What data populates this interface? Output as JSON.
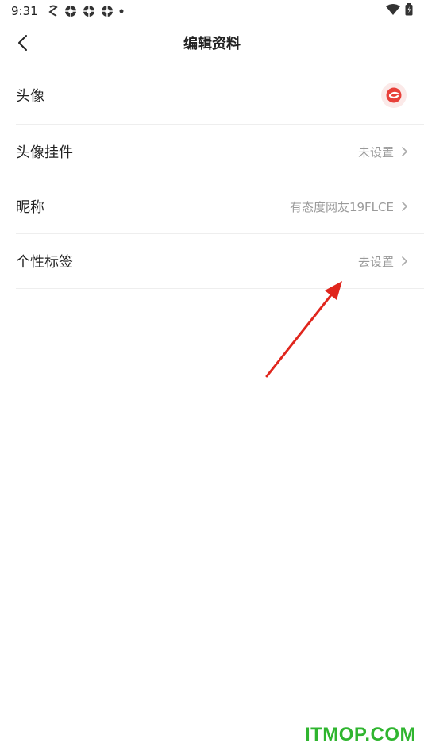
{
  "status_bar": {
    "time": "9:31",
    "icons": [
      "notification-app-icon",
      "ball-icon",
      "ball-icon",
      "ball-icon",
      "dot-icon"
    ],
    "right_icons": [
      "wifi-icon",
      "battery-icon"
    ]
  },
  "header": {
    "title": "编辑资料",
    "back_icon": "chevron-left-icon"
  },
  "profile_items": [
    {
      "label": "头像",
      "value": "",
      "type": "avatar"
    },
    {
      "label": "头像挂件",
      "value": "未设置"
    },
    {
      "label": "昵称",
      "value": "有态度网友19FLCE"
    },
    {
      "label": "个性标签",
      "value": "去设置"
    }
  ],
  "colors": {
    "avatar_accent": "#e8403a",
    "arrow": "#e0261d",
    "watermark": "#2fb52f"
  },
  "watermark": "ITMOP.COM"
}
